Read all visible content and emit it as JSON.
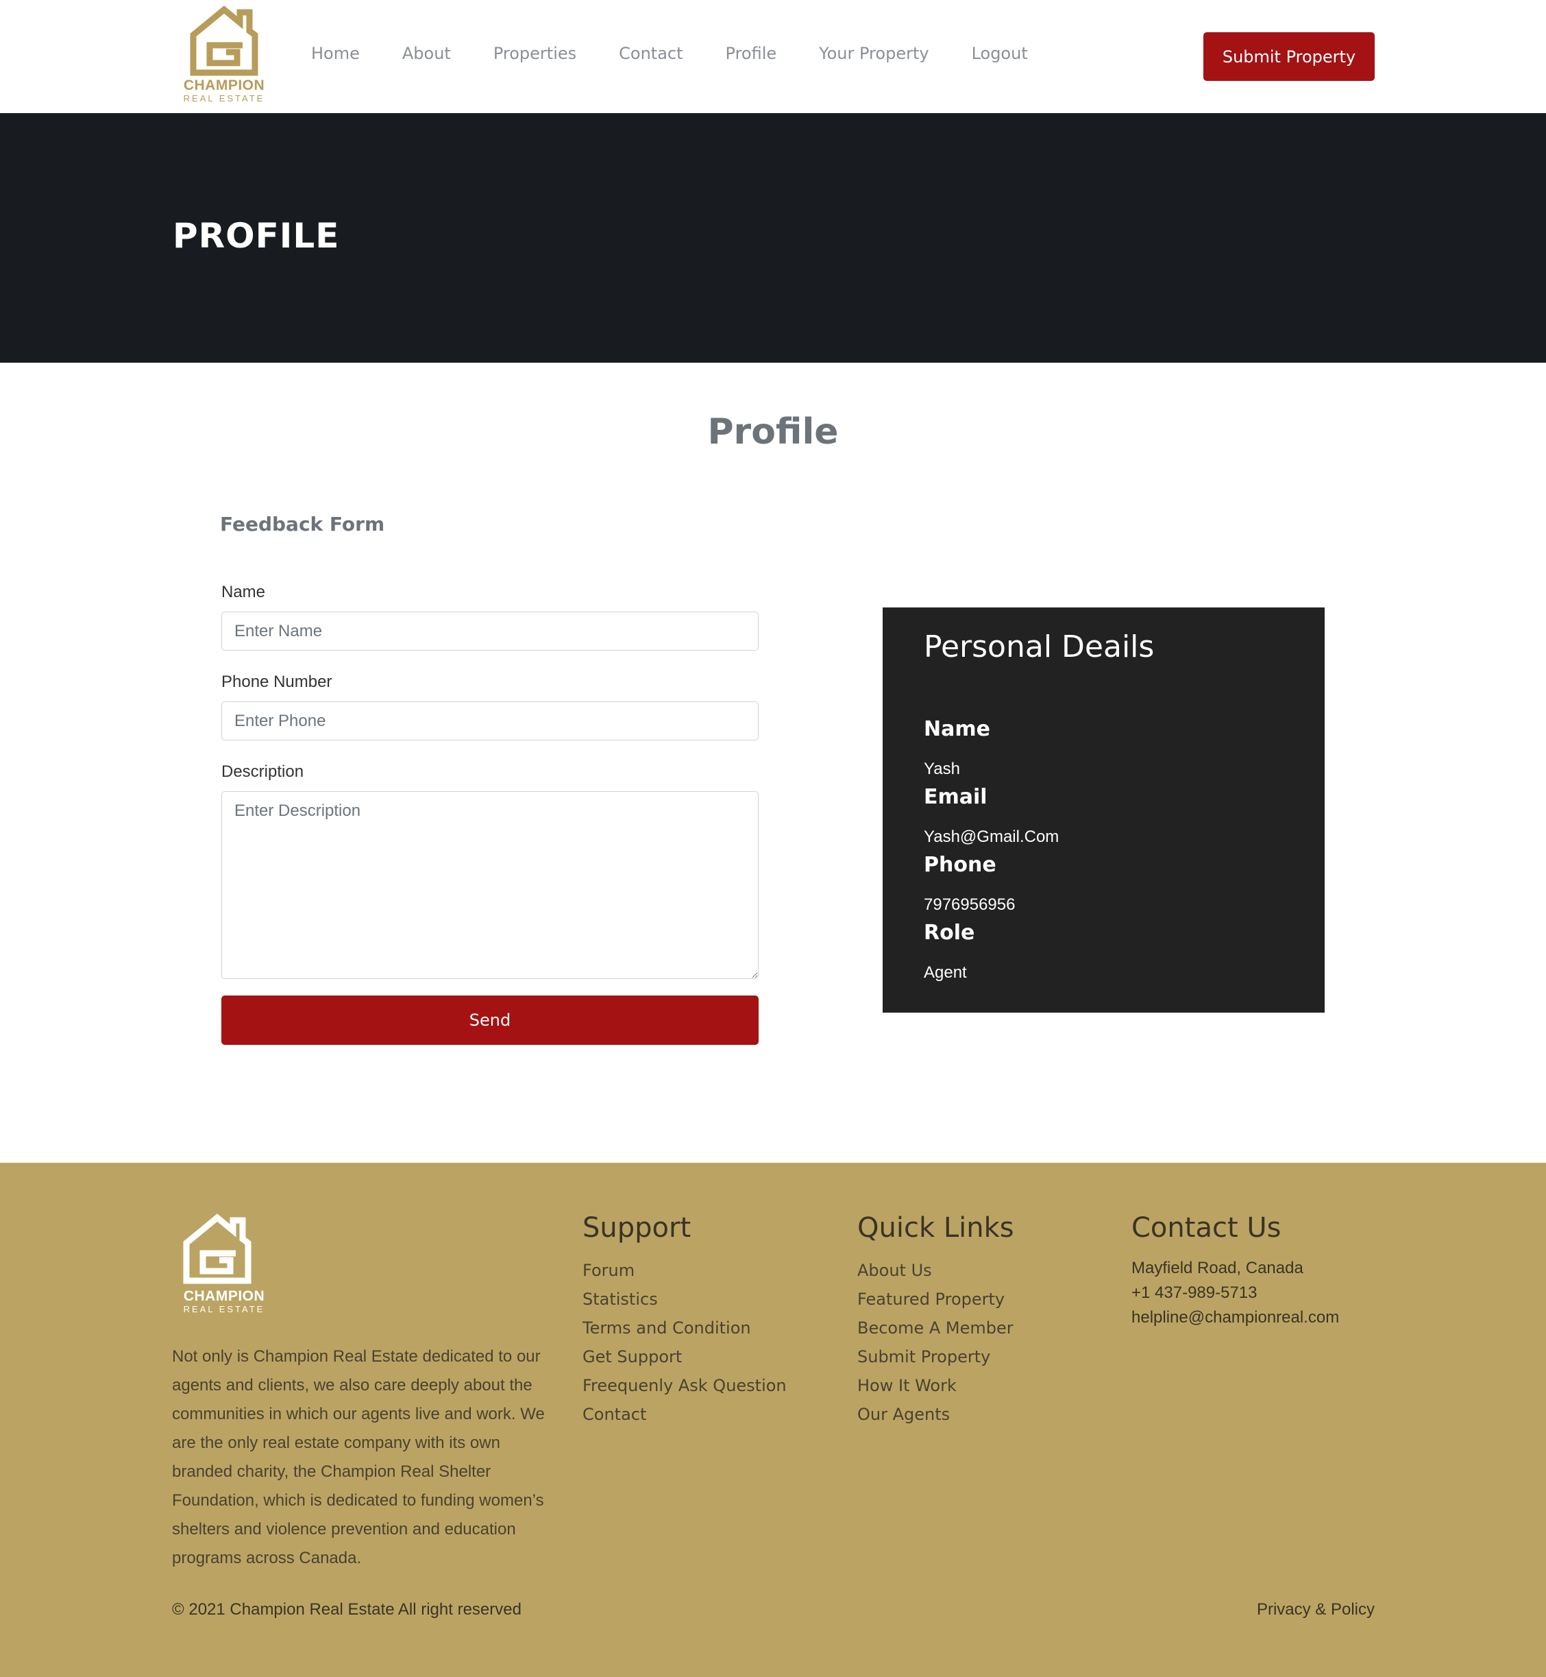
{
  "brand": {
    "name": "CHAMPION",
    "tagline": "REAL ESTATE",
    "gold_color": "#b79c5a",
    "accent_color": "#a41214"
  },
  "nav": {
    "items": [
      "Home",
      "About",
      "Properties",
      "Contact",
      "Profile",
      "Your Property",
      "Logout"
    ],
    "cta": "Submit Property"
  },
  "hero": {
    "title": "PROFILE"
  },
  "page": {
    "heading": "Profile"
  },
  "feedback_form": {
    "title": "Feedback Form",
    "name_label": "Name",
    "name_placeholder": "Enter Name",
    "phone_label": "Phone Number",
    "phone_placeholder": "Enter Phone",
    "description_label": "Description",
    "description_placeholder": "Enter Description",
    "send_label": "Send"
  },
  "personal_details": {
    "title": "Personal Deails",
    "fields": [
      {
        "label": "Name",
        "value": "Yash"
      },
      {
        "label": "Email",
        "value": "Yash@Gmail.Com"
      },
      {
        "label": "Phone",
        "value": "7976956956"
      },
      {
        "label": "Role",
        "value": "Agent"
      }
    ]
  },
  "footer": {
    "about": "Not only is Champion Real Estate dedicated to our agents and clients, we also care deeply about the communities in which our agents live and work. We are the only real estate company with its own branded charity, the Champion Real Shelter Foundation, which is dedicated to funding women’s shelters and violence prevention and education programs across Canada.",
    "support": {
      "title": "Support",
      "links": [
        "Forum",
        "Statistics",
        "Terms and Condition",
        "Get Support",
        "Freequenly Ask Question",
        "Contact"
      ]
    },
    "quick_links": {
      "title": "Quick Links",
      "links": [
        "About Us",
        "Featured Property",
        "Become A Member",
        "Submit Property",
        "How It Work",
        "Our Agents"
      ]
    },
    "contact": {
      "title": "Contact Us",
      "address": "Mayfield Road, Canada",
      "phone": "+1 437-989-5713",
      "email": "helpline@championreal.com"
    },
    "copyright": "© 2021 Champion Real Estate All right reserved",
    "privacy": "Privacy & Policy"
  }
}
